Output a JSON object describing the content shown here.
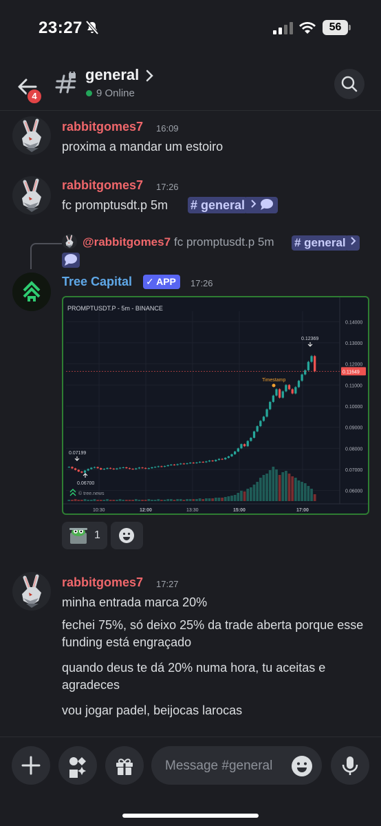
{
  "status_bar": {
    "time": "23:27",
    "battery": "56"
  },
  "header": {
    "back_badge": "4",
    "channel_name": "general",
    "online": "9 Online"
  },
  "messages": [
    {
      "author": "rabbitgomes7",
      "time": "16:09",
      "text": "proxima a mandar um estoiro"
    },
    {
      "author": "rabbitgomes7",
      "time": "17:26",
      "text": "fc promptusdt.p 5m",
      "chip_label": "# general"
    },
    {
      "reply": {
        "author": "@rabbitgomes7",
        "text": "fc promptusdt.p 5m",
        "chip_label": "# general"
      },
      "author": "Tree Capital",
      "badge": "✓ APP",
      "time": "17:26"
    },
    {
      "author": "rabbitgomes7",
      "time": "17:27",
      "lines": [
        "minha entrada marca 20%",
        "fechei 75%, só deixo 25% da trade aberta porque esse funding está engraçado",
        "quando deus te dá 20% numa hora, tu aceitas e agradeces",
        "vou jogar padel, beijocas larocas"
      ]
    }
  ],
  "reactions": [
    {
      "count": "1"
    }
  ],
  "composer": {
    "placeholder": "Message #general"
  },
  "chart_data": {
    "type": "candlestick",
    "title": "PROMPTUSDT.P - 5m - BINANCE",
    "watermark": "© tree.news",
    "x_ticks": [
      "10:30",
      "12:00",
      "13:30",
      "15:00",
      "17:00"
    ],
    "y_ticks": [
      "0.14000",
      "0.13000",
      "0.12000",
      "0.11000",
      "0.10000",
      "0.09000",
      "0.08000",
      "0.07000",
      "0.06000"
    ],
    "ylim": [
      0.055,
      0.145
    ],
    "current_price": "0.11649",
    "annotations": {
      "high": "0.07199",
      "low": "0.06700",
      "peak": "0.12369",
      "event": "Timestamp"
    },
    "close_values": [
      0.0712,
      0.0705,
      0.0698,
      0.069,
      0.0685,
      0.0695,
      0.0702,
      0.0708,
      0.0711,
      0.0706,
      0.07,
      0.0703,
      0.0707,
      0.0704,
      0.0701,
      0.0705,
      0.0708,
      0.071,
      0.0706,
      0.0703,
      0.0701,
      0.0705,
      0.0709,
      0.0707,
      0.0704,
      0.0706,
      0.071,
      0.0712,
      0.0715,
      0.0713,
      0.0716,
      0.072,
      0.0723,
      0.0721,
      0.0725,
      0.0728,
      0.0726,
      0.0729,
      0.0732,
      0.073,
      0.0733,
      0.0736,
      0.0734,
      0.0738,
      0.0742,
      0.0739,
      0.0745,
      0.075,
      0.0748,
      0.0755,
      0.0762,
      0.0772,
      0.0785,
      0.08,
      0.082,
      0.081,
      0.0835,
      0.085,
      0.088,
      0.0905,
      0.093,
      0.095,
      0.0985,
      0.102,
      0.105,
      0.108,
      0.104,
      0.107,
      0.11,
      0.108,
      0.106,
      0.109,
      0.112,
      0.115,
      0.117,
      0.121,
      0.1237,
      0.1165
    ],
    "volumes": [
      2,
      2,
      3,
      2,
      2,
      3,
      2,
      2,
      3,
      2,
      2,
      2,
      3,
      2,
      2,
      2,
      3,
      2,
      2,
      2,
      2,
      3,
      2,
      2,
      2,
      3,
      2,
      2,
      3,
      2,
      2,
      3,
      3,
      2,
      3,
      3,
      2,
      3,
      3,
      3,
      3,
      4,
      3,
      4,
      4,
      4,
      5,
      5,
      5,
      6,
      7,
      8,
      9,
      12,
      15,
      14,
      18,
      20,
      24,
      28,
      34,
      38,
      40,
      45,
      50,
      46,
      38,
      42,
      44,
      40,
      36,
      34,
      30,
      28,
      26,
      22,
      18,
      10
    ]
  }
}
